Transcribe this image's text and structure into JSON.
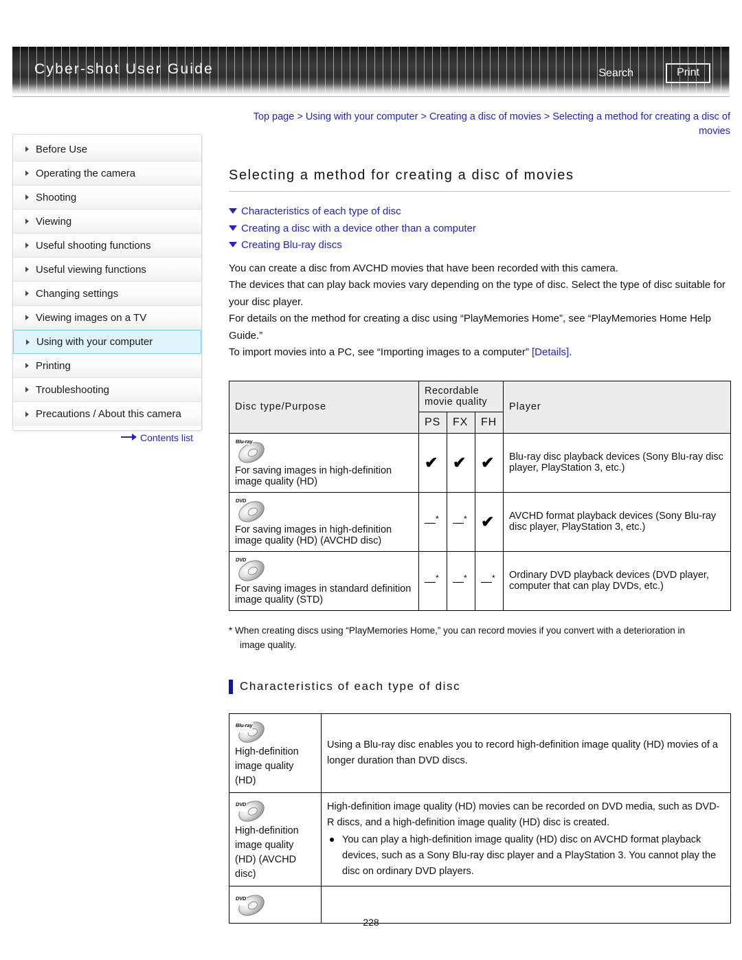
{
  "header": {
    "title": "Cyber-shot User Guide",
    "search_label": "Search",
    "print_label": "Print"
  },
  "sidebar": {
    "items": [
      {
        "label": "Before Use",
        "active": false
      },
      {
        "label": "Operating the camera",
        "active": false
      },
      {
        "label": "Shooting",
        "active": false
      },
      {
        "label": "Viewing",
        "active": false
      },
      {
        "label": "Useful shooting functions",
        "active": false
      },
      {
        "label": "Useful viewing functions",
        "active": false
      },
      {
        "label": "Changing settings",
        "active": false
      },
      {
        "label": "Viewing images on a TV",
        "active": false
      },
      {
        "label": "Using with your computer",
        "active": true
      },
      {
        "label": "Printing",
        "active": false
      },
      {
        "label": "Troubleshooting",
        "active": false
      },
      {
        "label": "Precautions / About this camera",
        "active": false
      }
    ],
    "contents_list_label": "Contents list"
  },
  "main": {
    "breadcrumb": "Top page > Using with your computer > Creating a disc of movies > Selecting a method for creating a disc of movies",
    "page_title": "Selecting a method for creating a disc of movies",
    "anchors": [
      "Characteristics of each type of disc",
      "Creating a disc with a device other than a computer",
      "Creating Blu-ray discs"
    ],
    "paragraphs": [
      "You can create a disc from AVCHD movies that have been recorded with this camera.",
      "The devices that can play back movies vary depending on the type of disc. Select the type of disc suitable for your disc player.",
      "For details on the method for creating a disc using “PlayMemories Home”, see “PlayMemories Home Help Guide.”"
    ],
    "last_paragraph_prefix": "To import movies into a PC, see “Importing images to a computer” ",
    "details_link": "[Details]",
    "last_paragraph_suffix": ".",
    "footnote_main": "* When creating discs using “PlayMemories Home,” you can record movies if you convert with a deterioration in",
    "footnote_cont": "image quality.",
    "section_heading": "Characteristics of each type of disc",
    "page_number": "228"
  },
  "table1": {
    "headers": {
      "disc_type": "Disc type/Purpose",
      "recordable": "Recordable",
      "movie_quality": "movie quality",
      "player": "Player",
      "quality_cols": [
        "PS",
        "FX",
        "FH"
      ]
    },
    "rows": [
      {
        "icon_tag": "Blu-ray",
        "purpose": "For saving images in high-definition image quality (HD)",
        "marks": [
          "check",
          "check",
          "check"
        ],
        "player": "Blu-ray disc playback devices (Sony Blu-ray disc player, PlayStation 3, etc.)"
      },
      {
        "icon_tag": "DVD",
        "purpose": "For saving images in high-definition image quality (HD) (AVCHD disc)",
        "marks": [
          "dash",
          "dash",
          "check"
        ],
        "player": "AVCHD format playback devices (Sony Blu-ray disc player, PlayStation 3, etc.)"
      },
      {
        "icon_tag": "DVD",
        "purpose": "For saving images in standard definition image quality (STD)",
        "marks": [
          "dash",
          "dash",
          "dash"
        ],
        "player": "Ordinary DVD playback devices (DVD player, computer that can play DVDs, etc.)"
      }
    ],
    "check_glyph": "✔",
    "dash_glyph": "—"
  },
  "table2": {
    "rows": [
      {
        "icon_tag": "Blu-ray",
        "label": "High-definition image quality (HD)",
        "body": "Using a Blu-ray disc enables you to record high-definition image quality (HD) movies of a longer duration than DVD discs.",
        "bullets": []
      },
      {
        "icon_tag": "DVD",
        "label": "High-definition image quality (HD) (AVCHD disc)",
        "body": "High-definition image quality (HD) movies can be recorded on DVD media, such as DVD-R discs, and a high-definition image quality (HD) disc is created.",
        "bullets": [
          "You can play a high-definition image quality (HD) disc on AVCHD format playback devices, such as a Sony Blu-ray disc player and a PlayStation 3. You cannot play the disc on ordinary DVD players."
        ]
      },
      {
        "icon_tag": "DVD",
        "label": "",
        "body": "",
        "bullets": []
      }
    ]
  }
}
